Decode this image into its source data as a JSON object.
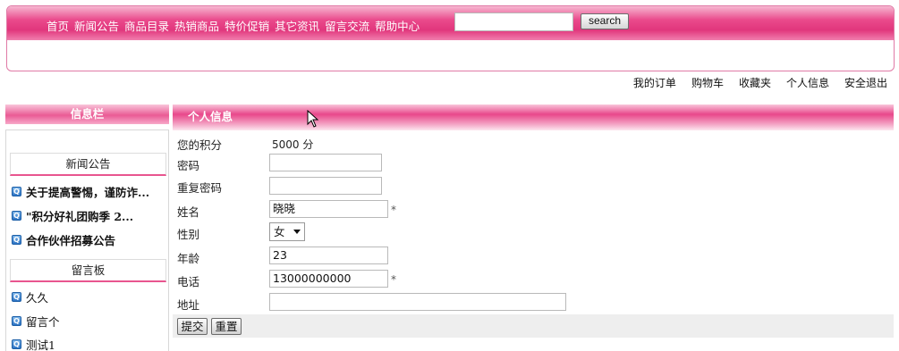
{
  "nav": {
    "items": [
      "首页",
      "新闻公告",
      "商品目录",
      "热销商品",
      "特价促销",
      "其它资讯",
      "留言交流",
      "帮助中心"
    ],
    "search_value": "",
    "search_button": "search"
  },
  "user_links": [
    "我的订单",
    "购物车",
    "收藏夹",
    "个人信息",
    "安全退出"
  ],
  "sidebar": {
    "header": "信息栏",
    "news_title": "新闻公告",
    "news_items": [
      "关于提高警惕，谨防诈...",
      "\"积分好礼团购季  2...",
      "合作伙伴招募公告"
    ],
    "guestbook_title": "留言板",
    "guestbook_items": [
      "久久",
      "留言个",
      "测试1"
    ],
    "item_icon": "Q"
  },
  "main": {
    "header": "个人信息",
    "points_label": "您的积分",
    "points_value": "5000 分",
    "password_label": "密码",
    "password_value": "",
    "confirm_label": "重复密码",
    "confirm_value": "",
    "name_label": "姓名",
    "name_value": "晓晓",
    "gender_label": "性别",
    "gender_value": "女",
    "age_label": "年龄",
    "age_value": "23",
    "phone_label": "电话",
    "phone_value": "13000000000",
    "address_label": "地址",
    "address_value": "",
    "required_mark": "*",
    "submit_label": "提交",
    "reset_label": "重置"
  },
  "colors": {
    "accent": "#e1367c",
    "accent_light": "#f7a9c9",
    "icon_blue": "#2c73c4"
  }
}
